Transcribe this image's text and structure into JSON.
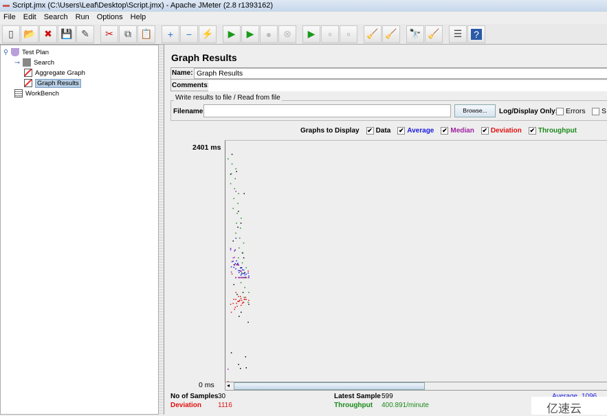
{
  "window": {
    "title": "Script.jmx (C:\\Users\\Leaf\\Desktop\\Script.jmx) - Apache JMeter (2.8 r1393162)"
  },
  "menu": [
    "File",
    "Edit",
    "Search",
    "Run",
    "Options",
    "Help"
  ],
  "toolbar": [
    "new-icon",
    "open-icon",
    "close-icon",
    "save-icon",
    "save-as-icon",
    "|",
    "cut-icon",
    "copy-icon",
    "paste-icon",
    "|",
    "expand-icon",
    "collapse-icon",
    "toggle-icon",
    "|",
    "start-icon",
    "start-no-pause-icon",
    "stop-icon",
    "shutdown-icon",
    "|",
    "remote-start-icon",
    "remote-stop-icon",
    "remote-shutdown-icon",
    "|",
    "clear-icon",
    "clear-all-icon",
    "|",
    "search-icon",
    "reset-search-icon",
    "|",
    "function-helper-icon",
    "help-icon"
  ],
  "tree": [
    {
      "label": "Test Plan"
    },
    {
      "label": "Search"
    },
    {
      "label": "Aggregate Graph"
    },
    {
      "label": "Graph Results",
      "selected": true
    },
    {
      "label": "WorkBench"
    }
  ],
  "panel": {
    "title": "Graph Results",
    "name_label": "Name:",
    "name_value": "Graph Results",
    "comments_label": "Comments:",
    "comments_value": "",
    "file_group": "Write results to file / Read from file",
    "filename_label": "Filename",
    "filename_value": "",
    "browse": "Browse...",
    "log_only": "Log/Display Only:",
    "errors": "Errors",
    "successes": "S",
    "graphs_label": "Graphs to Display",
    "graphs": [
      {
        "label": "Data",
        "color": "#000000",
        "checked": true
      },
      {
        "label": "Average",
        "color": "#1a1adc",
        "checked": true
      },
      {
        "label": "Median",
        "color": "#a020a0",
        "checked": true
      },
      {
        "label": "Deviation",
        "color": "#e01010",
        "checked": true
      },
      {
        "label": "Throughput",
        "color": "#1a8a1a",
        "checked": true
      }
    ]
  },
  "chart_data": {
    "type": "scatter",
    "ymax_label": "2401 ms",
    "ymin_label": "0 ms",
    "ylim": [
      0,
      2401
    ],
    "series": [
      {
        "name": "Data",
        "color": "#000000",
        "values": [
          125,
          2297,
          1922,
          291,
          1330,
          2096,
          1180,
          173,
          980,
          1560,
          1420,
          880,
          700,
          2123,
          132,
          1050,
          820,
          1250,
          659,
          900,
          1720,
          1300,
          139,
          1150,
          250,
          1600,
          1100,
          780,
          1900,
          599
        ]
      },
      {
        "name": "Average",
        "color": "#1a1adc",
        "values": [
          125,
          1211,
          1448,
          1159,
          1193,
          1344,
          1320,
          1176,
          1154,
          1195,
          1216,
          1188,
          1151,
          1220,
          1148,
          1139,
          1120,
          1126,
          1101,
          1091,
          1121,
          1129,
          1085,
          1088,
          1054,
          1075,
          1077,
          1066,
          1094,
          1096
        ]
      },
      {
        "name": "Median",
        "color": "#a020a0",
        "values": [
          125,
          1211,
          1922,
          1106,
          1330,
          1330,
          1255,
          1180,
          1180,
          1180,
          1250,
          1180,
          1115,
          1180,
          1115,
          1050,
          1050,
          1050,
          1050,
          1050,
          1050,
          1050,
          1050,
          1050,
          1050,
          1050,
          1050,
          1050,
          1050,
          1050
        ]
      },
      {
        "name": "Deviation",
        "color": "#e01010",
        "values": [
          0,
          1086,
          900,
          700,
          750,
          780,
          730,
          860,
          830,
          810,
          790,
          760,
          770,
          790,
          860,
          830,
          820,
          800,
          810,
          800,
          810,
          790,
          830,
          820,
          850,
          840,
          830,
          820,
          830,
          1116
        ]
      },
      {
        "name": "Throughput",
        "color": "#1a8a1a",
        "values": [
          2250,
          2200,
          2150,
          2100,
          2050,
          2000,
          1950,
          1900,
          1850,
          1800,
          1750,
          1700,
          1650,
          1600,
          1550,
          1500,
          1450,
          1400,
          1350,
          1300,
          1250,
          1200,
          1150,
          1100,
          1050,
          1000,
          950,
          900,
          850,
          800
        ]
      }
    ]
  },
  "stats": {
    "samples_label": "No of Samples",
    "samples": "30",
    "latest_label": "Latest Sample",
    "latest": "599",
    "average_label": "Average",
    "average": "1096",
    "deviation_label": "Deviation",
    "deviation": "1116",
    "throughput_label": "Throughput",
    "throughput": "400.891/minute"
  },
  "watermark": "亿速云"
}
